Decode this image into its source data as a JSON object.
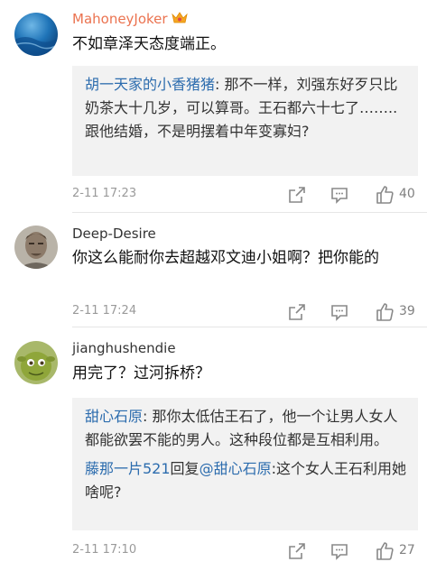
{
  "comments": [
    {
      "username": "MahoneyJoker",
      "badge_icon": "vip-crown-icon",
      "text": "不如章泽天态度端正。",
      "replies": [
        {
          "name": "胡一天家的小香猪猪",
          "sep": ": ",
          "content": "那不一样，刘强东好歹只比奶茶大十几岁，可以算哥。王石都六十七了……..跟他结婚，不是明摆着中年变寡妇?"
        }
      ],
      "time": "2-11 17:23",
      "likes": "40"
    },
    {
      "username": "Deep-Desire",
      "text": "你这么能耐你去超越邓文迪小姐啊？把你能的",
      "replies": [],
      "time": "2-11 17:24",
      "likes": "39"
    },
    {
      "username": "jianghushendie",
      "text": "用完了？过河拆桥？",
      "replies": [
        {
          "name": "甜心石原",
          "sep": ": ",
          "content": "那你太低估王石了，他一个让男人女人都能欲罢不能的男人。这种段位都是互相利用。"
        },
        {
          "name": "藤那一片521",
          "sep": "",
          "content": "回复",
          "mention": "@甜心石原",
          "content2": ":这个女人王石利用她啥呢?"
        }
      ],
      "time": "2-11 17:10",
      "likes": "27"
    }
  ],
  "colors": {
    "vip_name": "#eb7350",
    "link": "#2c6cae",
    "reply_bg": "#f2f2f2"
  }
}
